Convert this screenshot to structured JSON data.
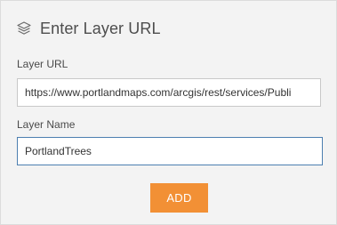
{
  "header": {
    "icon": "layers-icon",
    "title": "Enter Layer URL"
  },
  "form": {
    "url_label": "Layer URL",
    "url_value": "https://www.portlandmaps.com/arcgis/rest/services/Publi",
    "name_label": "Layer Name",
    "name_value": "PortlandTrees",
    "add_label": "ADD"
  },
  "colors": {
    "panel_bg": "#f3f3f3",
    "accent": "#f29035",
    "focus_border": "#4c7fb0"
  }
}
